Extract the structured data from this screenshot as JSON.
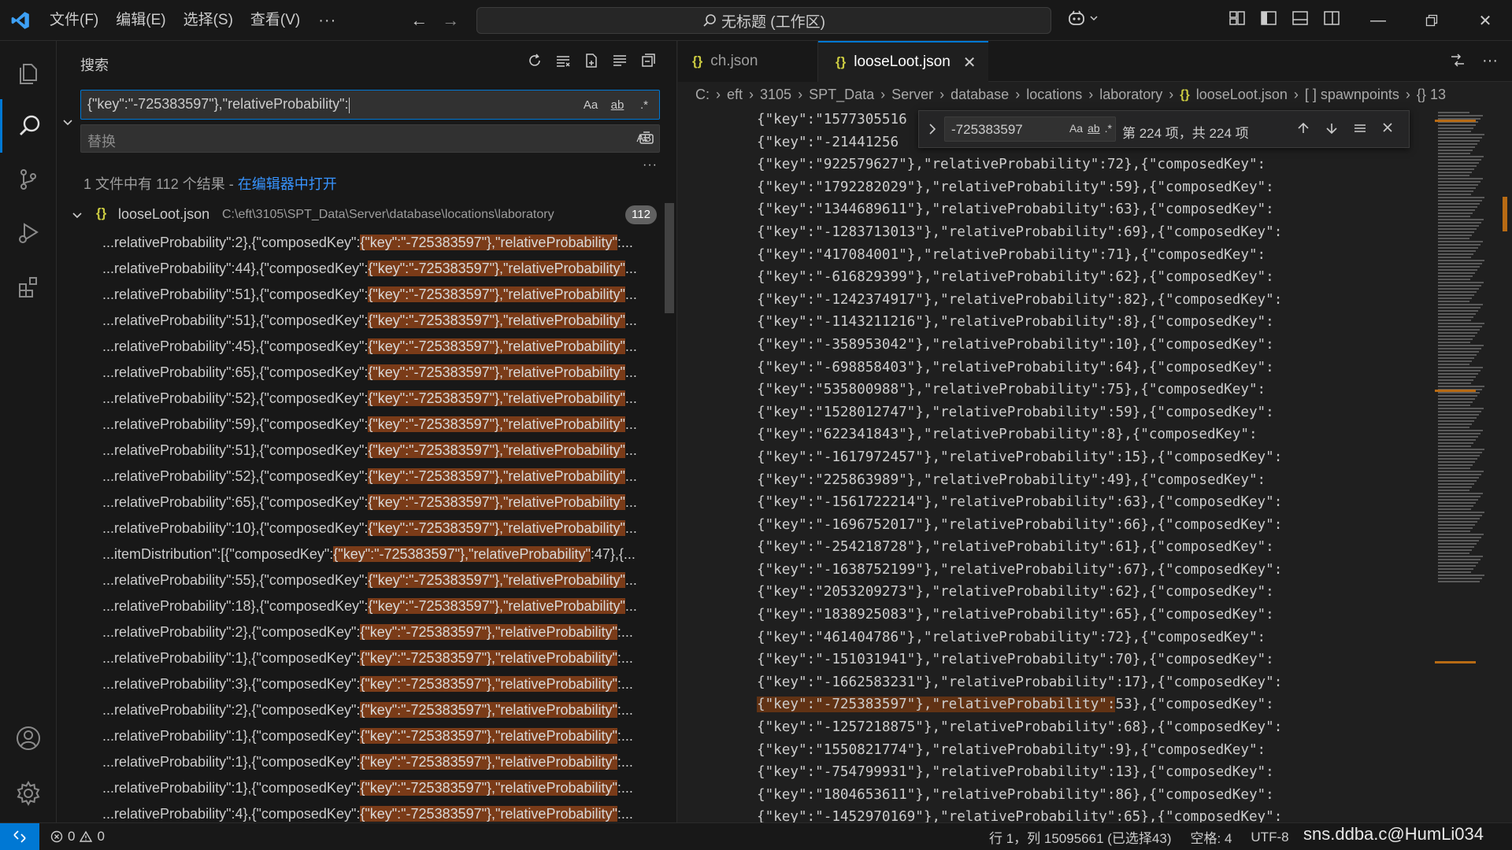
{
  "menu": [
    "文件(F)",
    "编辑(E)",
    "选择(S)",
    "查看(V)"
  ],
  "menu_more": "···",
  "command_center": "无标题 (工作区)",
  "sidebar": {
    "title": "搜索",
    "search_value": "{\"key\":\"-725383597\"},\"relativeProbability\":",
    "toggle_case": "Aa",
    "toggle_word": "ab",
    "toggle_regex": ".*",
    "replace_placeholder": "替换",
    "preserve_case": "AB",
    "more": "···",
    "summary_text": "1 文件中有 112 个结果 - ",
    "summary_link": "在编辑器中打开",
    "file": {
      "name": "looseLoot.json",
      "path": "C:\\eft\\3105\\SPT_Data\\Server\\database\\locations\\laboratory",
      "count": "112"
    },
    "results": [
      {
        "pre": "...relativeProbability\":2},{\"composedKey\":",
        "hit": "{\"key\":\"-725383597\"},\"relativeProbability\"",
        "post": ":..."
      },
      {
        "pre": "...relativeProbability\":44},{\"composedKey\":",
        "hit": "{\"key\":\"-725383597\"},\"relativeProbability\"",
        "post": "..."
      },
      {
        "pre": "...relativeProbability\":51},{\"composedKey\":",
        "hit": "{\"key\":\"-725383597\"},\"relativeProbability\"",
        "post": "..."
      },
      {
        "pre": "...relativeProbability\":51},{\"composedKey\":",
        "hit": "{\"key\":\"-725383597\"},\"relativeProbability\"",
        "post": "..."
      },
      {
        "pre": "...relativeProbability\":45},{\"composedKey\":",
        "hit": "{\"key\":\"-725383597\"},\"relativeProbability\"",
        "post": "..."
      },
      {
        "pre": "...relativeProbability\":65},{\"composedKey\":",
        "hit": "{\"key\":\"-725383597\"},\"relativeProbability\"",
        "post": "..."
      },
      {
        "pre": "...relativeProbability\":52},{\"composedKey\":",
        "hit": "{\"key\":\"-725383597\"},\"relativeProbability\"",
        "post": "..."
      },
      {
        "pre": "...relativeProbability\":59},{\"composedKey\":",
        "hit": "{\"key\":\"-725383597\"},\"relativeProbability\"",
        "post": "..."
      },
      {
        "pre": "...relativeProbability\":51},{\"composedKey\":",
        "hit": "{\"key\":\"-725383597\"},\"relativeProbability\"",
        "post": "..."
      },
      {
        "pre": "...relativeProbability\":52},{\"composedKey\":",
        "hit": "{\"key\":\"-725383597\"},\"relativeProbability\"",
        "post": "..."
      },
      {
        "pre": "...relativeProbability\":65},{\"composedKey\":",
        "hit": "{\"key\":\"-725383597\"},\"relativeProbability\"",
        "post": "..."
      },
      {
        "pre": "...relativeProbability\":10},{\"composedKey\":",
        "hit": "{\"key\":\"-725383597\"},\"relativeProbability\"",
        "post": "..."
      },
      {
        "pre": "...itemDistribution\":[{\"composedKey\":",
        "hit": "{\"key\":\"-725383597\"},\"relativeProbability\"",
        "post": ":47},{..."
      },
      {
        "pre": "...relativeProbability\":55},{\"composedKey\":",
        "hit": "{\"key\":\"-725383597\"},\"relativeProbability\"",
        "post": "..."
      },
      {
        "pre": "...relativeProbability\":18},{\"composedKey\":",
        "hit": "{\"key\":\"-725383597\"},\"relativeProbability\"",
        "post": "..."
      },
      {
        "pre": "...relativeProbability\":2},{\"composedKey\":",
        "hit": "{\"key\":\"-725383597\"},\"relativeProbability\"",
        "post": ":..."
      },
      {
        "pre": "...relativeProbability\":1},{\"composedKey\":",
        "hit": "{\"key\":\"-725383597\"},\"relativeProbability\"",
        "post": ":..."
      },
      {
        "pre": "...relativeProbability\":3},{\"composedKey\":",
        "hit": "{\"key\":\"-725383597\"},\"relativeProbability\"",
        "post": ":..."
      },
      {
        "pre": "...relativeProbability\":2},{\"composedKey\":",
        "hit": "{\"key\":\"-725383597\"},\"relativeProbability\"",
        "post": ":..."
      },
      {
        "pre": "...relativeProbability\":1},{\"composedKey\":",
        "hit": "{\"key\":\"-725383597\"},\"relativeProbability\"",
        "post": ":..."
      },
      {
        "pre": "...relativeProbability\":1},{\"composedKey\":",
        "hit": "{\"key\":\"-725383597\"},\"relativeProbability\"",
        "post": ":..."
      },
      {
        "pre": "...relativeProbability\":1},{\"composedKey\":",
        "hit": "{\"key\":\"-725383597\"},\"relativeProbability\"",
        "post": ":..."
      },
      {
        "pre": "...relativeProbability\":4},{\"composedKey\":",
        "hit": "{\"key\":\"-725383597\"},\"relativeProbability\"",
        "post": ":..."
      }
    ]
  },
  "tabs": [
    {
      "label": "ch.json",
      "icon": "{}"
    },
    {
      "label": "looseLoot.json",
      "icon": "{}",
      "close": "✕"
    }
  ],
  "breadcrumb": [
    "C:",
    "eft",
    "3105",
    "SPT_Data",
    "Server",
    "database",
    "locations",
    "laboratory",
    "looseLoot.json",
    "[ ] spawnpoints",
    "{} 13"
  ],
  "find_widget": {
    "value": "-725383597",
    "toggle_case": "Aa",
    "toggle_word": "ab",
    "toggle_regex": ".*",
    "count": "第 224 项，共 224 项"
  },
  "code_lines": [
    {
      "t": "{\"key\":\"1577305516",
      "hl": false
    },
    {
      "t": "{\"key\":\"-21441256",
      "hl": false
    },
    {
      "t": "{\"key\":\"922579627\"},\"relativeProbability\":72},{\"composedKey\":",
      "hl": false
    },
    {
      "t": "{\"key\":\"1792282029\"},\"relativeProbability\":59},{\"composedKey\":",
      "hl": false
    },
    {
      "t": "{\"key\":\"1344689611\"},\"relativeProbability\":63},{\"composedKey\":",
      "hl": false
    },
    {
      "t": "{\"key\":\"-1283713013\"},\"relativeProbability\":69},{\"composedKey\":",
      "hl": false
    },
    {
      "t": "{\"key\":\"417084001\"},\"relativeProbability\":71},{\"composedKey\":",
      "hl": false
    },
    {
      "t": "{\"key\":\"-616829399\"},\"relativeProbability\":62},{\"composedKey\":",
      "hl": false
    },
    {
      "t": "{\"key\":\"-1242374917\"},\"relativeProbability\":82},{\"composedKey\":",
      "hl": false
    },
    {
      "t": "{\"key\":\"-1143211216\"},\"relativeProbability\":8},{\"composedKey\":",
      "hl": false
    },
    {
      "t": "{\"key\":\"-358953042\"},\"relativeProbability\":10},{\"composedKey\":",
      "hl": false
    },
    {
      "t": "{\"key\":\"-698858403\"},\"relativeProbability\":64},{\"composedKey\":",
      "hl": false
    },
    {
      "t": "{\"key\":\"535800988\"},\"relativeProbability\":75},{\"composedKey\":",
      "hl": false
    },
    {
      "t": "{\"key\":\"1528012747\"},\"relativeProbability\":59},{\"composedKey\":",
      "hl": false
    },
    {
      "t": "{\"key\":\"622341843\"},\"relativeProbability\":8},{\"composedKey\":",
      "hl": false
    },
    {
      "t": "{\"key\":\"-1617972457\"},\"relativeProbability\":15},{\"composedKey\":",
      "hl": false
    },
    {
      "t": "{\"key\":\"225863989\"},\"relativeProbability\":49},{\"composedKey\":",
      "hl": false
    },
    {
      "t": "{\"key\":\"-1561722214\"},\"relativeProbability\":63},{\"composedKey\":",
      "hl": false
    },
    {
      "t": "{\"key\":\"-1696752017\"},\"relativeProbability\":66},{\"composedKey\":",
      "hl": false
    },
    {
      "t": "{\"key\":\"-254218728\"},\"relativeProbability\":61},{\"composedKey\":",
      "hl": false
    },
    {
      "t": "{\"key\":\"-1638752199\"},\"relativeProbability\":67},{\"composedKey\":",
      "hl": false
    },
    {
      "t": "{\"key\":\"2053209273\"},\"relativeProbability\":62},{\"composedKey\":",
      "hl": false
    },
    {
      "t": "{\"key\":\"1838925083\"},\"relativeProbability\":65},{\"composedKey\":",
      "hl": false
    },
    {
      "t": "{\"key\":\"461404786\"},\"relativeProbability\":72},{\"composedKey\":",
      "hl": false
    },
    {
      "t": "{\"key\":\"-151031941\"},\"relativeProbability\":70},{\"composedKey\":",
      "hl": false
    },
    {
      "t": "{\"key\":\"-1662583231\"},\"relativeProbability\":17},{\"composedKey\":",
      "hl": false
    },
    {
      "t": "{\"key\":\"-725383597\"},\"relativeProbability\":",
      "hl": true,
      "post": "53},{\"composedKey\":"
    },
    {
      "t": "{\"key\":\"-1257218875\"},\"relativeProbability\":68},{\"composedKey\":",
      "hl": false
    },
    {
      "t": "{\"key\":\"1550821774\"},\"relativeProbability\":9},{\"composedKey\":",
      "hl": false
    },
    {
      "t": "{\"key\":\"-754799931\"},\"relativeProbability\":13},{\"composedKey\":",
      "hl": false
    },
    {
      "t": "{\"key\":\"1804653611\"},\"relativeProbability\":86},{\"composedKey\":",
      "hl": false
    },
    {
      "t": "{\"key\":\"-1452970169\"},\"relativeProbability\":65},{\"composedKey\":",
      "hl": false
    }
  ],
  "status": {
    "errors": "0",
    "warnings": "0",
    "position": "行 1，列 15095661 (已选择43)",
    "spaces": "空格: 4",
    "encoding": "UTF-8",
    "watermark": "sns.ddba.c@HumLi034"
  },
  "colors": {
    "accent": "#0078d4",
    "match_highlight": "#7a3b18",
    "json_icon": "#cbcb41"
  }
}
